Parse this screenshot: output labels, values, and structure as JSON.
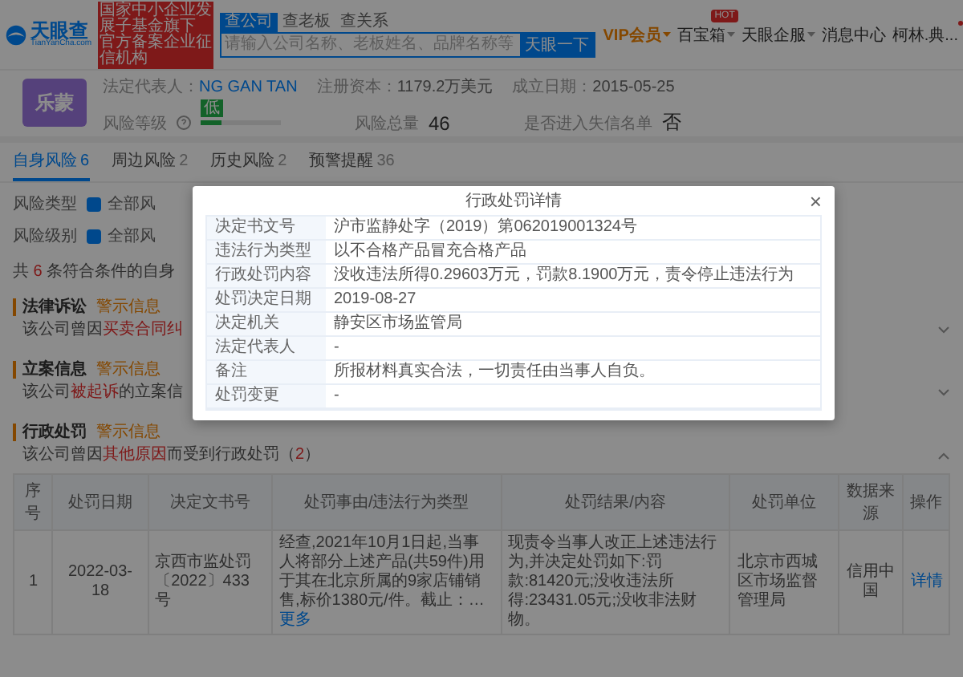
{
  "header": {
    "logo": {
      "name": "天眼查",
      "domain": "TianYanCha.com"
    },
    "banner": [
      "国家中小企业发展子基金旗下",
      "官方备案企业征信机构"
    ],
    "search_tabs": [
      {
        "label": "查公司",
        "selected": true
      },
      {
        "label": "查老板",
        "selected": false
      },
      {
        "label": "查关系",
        "selected": false
      }
    ],
    "search": {
      "placeholder": "请输入公司名称、老板姓名、品牌名称等",
      "button": "天眼一下"
    },
    "nav": [
      {
        "label": "VIP会员",
        "kind": "vip"
      },
      {
        "label": "百宝箱",
        "kind": "menu",
        "badge": "HOT"
      },
      {
        "label": "天眼企服",
        "kind": "menu"
      },
      {
        "label": "消息中心",
        "kind": "plain"
      },
      {
        "label": "柯林.典...",
        "kind": "user"
      }
    ]
  },
  "company": {
    "avatar": "乐蒙",
    "info": [
      {
        "label": "法定代表人：",
        "value": "NG GAN TAN",
        "link": true
      },
      {
        "label": "注册资本：",
        "value": "1179.2万美元",
        "link": false
      },
      {
        "label": "成立日期：",
        "value": "2015-05-25",
        "link": false
      }
    ],
    "risk": {
      "label": "风险等级",
      "badge": "低",
      "level": 0.25,
      "total_label": "风险总量",
      "total": "46",
      "blacklist_label": "是否进入失信名单",
      "blacklist": "否"
    }
  },
  "tabs": [
    {
      "label": "自身风险",
      "count": "6",
      "selected": true
    },
    {
      "label": "周边风险",
      "count": "2",
      "selected": false
    },
    {
      "label": "历史风险",
      "count": "2",
      "selected": false
    },
    {
      "label": "预警提醒",
      "count": "36",
      "selected": false
    }
  ],
  "filters": [
    {
      "label": "风险类型",
      "option": "全部风",
      "checked": true
    },
    {
      "label": "风险级别",
      "option": "全部风",
      "checked": true
    }
  ],
  "summary": [
    {
      "text": "共 ",
      "hl": false
    },
    {
      "text": "6",
      "hl": true
    },
    {
      "text": " 条符合条件的自身",
      "hl": false
    }
  ],
  "sections": [
    {
      "title": "法律诉讼",
      "tag": "警示信息",
      "expanded": false,
      "text": [
        {
          "text": "该公司曾因",
          "hl": false
        },
        {
          "text": "买卖合同纠",
          "hl": true
        }
      ]
    },
    {
      "title": "立案信息",
      "tag": "警示信息",
      "expanded": false,
      "text": [
        {
          "text": "该公司",
          "hl": false
        },
        {
          "text": "被起诉",
          "hl": true
        },
        {
          "text": "的立案信",
          "hl": false
        }
      ]
    },
    {
      "title": "行政处罚",
      "tag": "警示信息",
      "expanded": true,
      "text": [
        {
          "text": "该公司曾因",
          "hl": false
        },
        {
          "text": "其他原因",
          "hl": true
        },
        {
          "text": "而受到行政处罚（",
          "hl": false
        },
        {
          "text": "2",
          "hl": true
        },
        {
          "text": "）",
          "hl": false
        }
      ],
      "table": {
        "columns": [
          "序号",
          "处罚日期",
          "决定文书号",
          "处罚事由/违法行为类型",
          "处罚结果/内容",
          "处罚单位",
          "数据来源",
          "操作"
        ],
        "rows": [
          {
            "cells": [
              "1",
              "2022-03-18",
              "京西市监处罚〔2022〕433号",
              "经查,2021年10月1日起,当事人将部分上述产品(共59件)用于其在北京所属的9家店铺销售,标价1380元/件。截止：…",
              "现责令当事人改正上述违法行为,并决定处罚如下:罚款:81420元;没收违法所得:23431.05元;没收非法财物。",
              "北京市西城区市场监督管理局",
              "信用中国"
            ],
            "more": "更多",
            "action": "详情"
          }
        ]
      }
    }
  ],
  "modal": {
    "title": "行政处罚详情",
    "close": "×",
    "rows": [
      {
        "label": "决定书文号",
        "value": "沪市监静处字（2019）第062019001324号"
      },
      {
        "label": "违法行为类型",
        "value": "以不合格产品冒充合格产品"
      },
      {
        "label": "行政处罚内容",
        "value": "没收违法所得0.29603万元，罚款8.1900万元，责令停止违法行为"
      },
      {
        "label": "处罚决定日期",
        "value": "2019-08-27"
      },
      {
        "label": "决定机关",
        "value": "静安区市场监管局"
      },
      {
        "label": "法定代表人",
        "value": "-"
      },
      {
        "label": "备注",
        "value": "所报材料真实合法，一切责任由当事人自负。"
      },
      {
        "label": "处罚变更",
        "value": "-"
      }
    ]
  }
}
